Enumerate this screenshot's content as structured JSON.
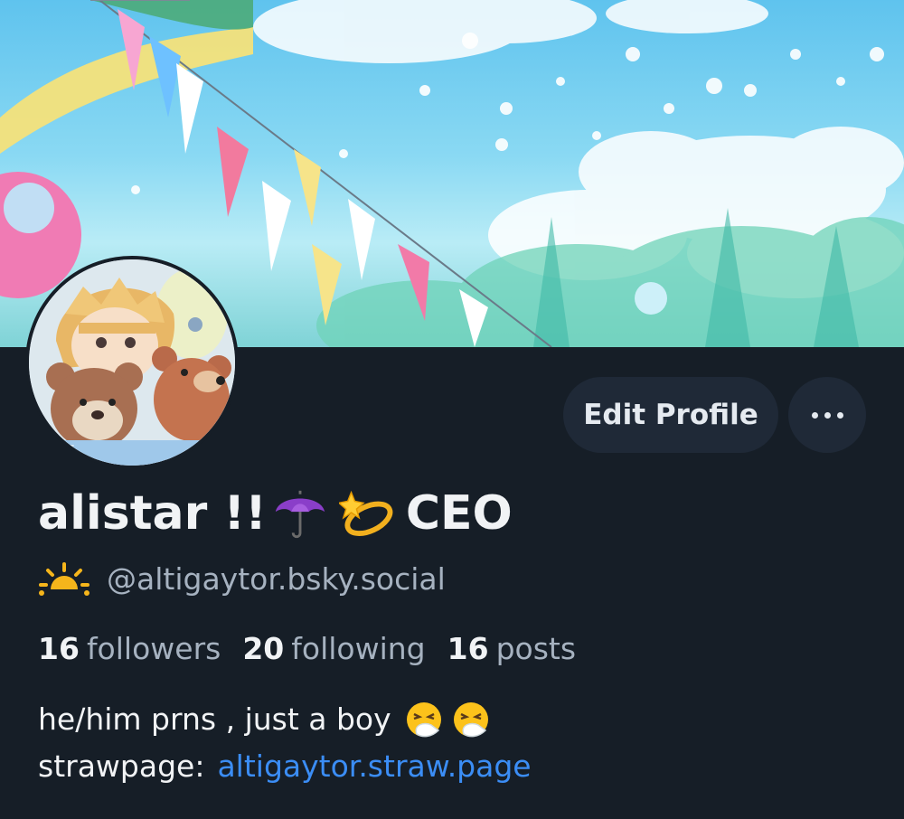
{
  "profile": {
    "display_name_text": "alistar !!",
    "display_name_emoji_1": "umbrella-emoji",
    "display_name_emoji_2": "dizzy-emoji",
    "display_name_suffix": "CEO",
    "handle_icon": "sunrise-icon",
    "handle": "@altigaytor.bsky.social"
  },
  "actions": {
    "edit_profile_label": "Edit Profile",
    "more_icon": "ellipsis-icon"
  },
  "stats": {
    "followers_count": "16",
    "followers_label": "followers",
    "following_count": "20",
    "following_label": "following",
    "posts_count": "16",
    "posts_label": "posts"
  },
  "bio": {
    "line1_text": "he/him prns , just a boy",
    "line1_emoji": "sneezing-face-emoji",
    "line2_prefix": "strawpage:",
    "line2_link": "altigaytor.straw.page"
  },
  "colors": {
    "background": "#161e27",
    "button_bg": "#1f2937",
    "primary_text": "#f1f3f5",
    "secondary_text": "#a6b2c0",
    "link": "#3b8df5"
  }
}
